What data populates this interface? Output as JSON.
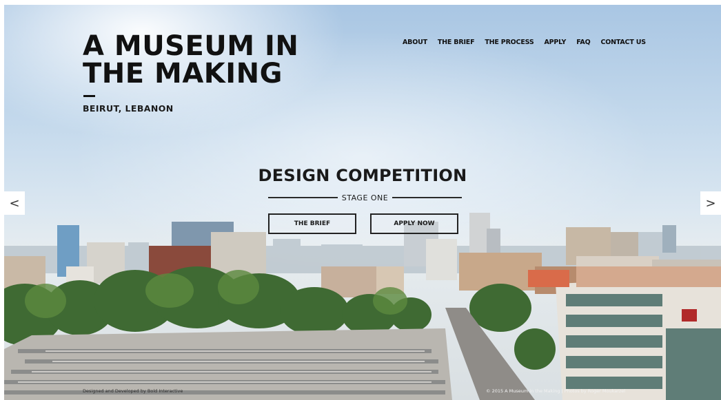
{
  "site": {
    "title_line1": "A MUSEUM IN",
    "title_line2": "THE MAKING",
    "location": "BEIRUT, LEBANON"
  },
  "nav": {
    "items": [
      {
        "label": "ABOUT"
      },
      {
        "label": "THE BRIEF"
      },
      {
        "label": "THE PROCESS"
      },
      {
        "label": "APPLY"
      },
      {
        "label": "FAQ"
      },
      {
        "label": "CONTACT US"
      }
    ]
  },
  "hero": {
    "title": "DESIGN COMPETITION",
    "subtitle": "STAGE ONE",
    "buttons": {
      "brief": "THE BRIEF",
      "apply": "APPLY NOW"
    },
    "prev_arrow": "<",
    "next_arrow": ">"
  },
  "footer": {
    "left": "Designed and Developed by Bold Interactive",
    "right": "© 2015 A Museum in the Making | Photos by Roger Moukarzel"
  },
  "colors": {
    "text": "#111111",
    "sky": "#c4d9ec"
  },
  "icons": {
    "prev": "chevron-left-icon",
    "next": "chevron-right-icon"
  }
}
